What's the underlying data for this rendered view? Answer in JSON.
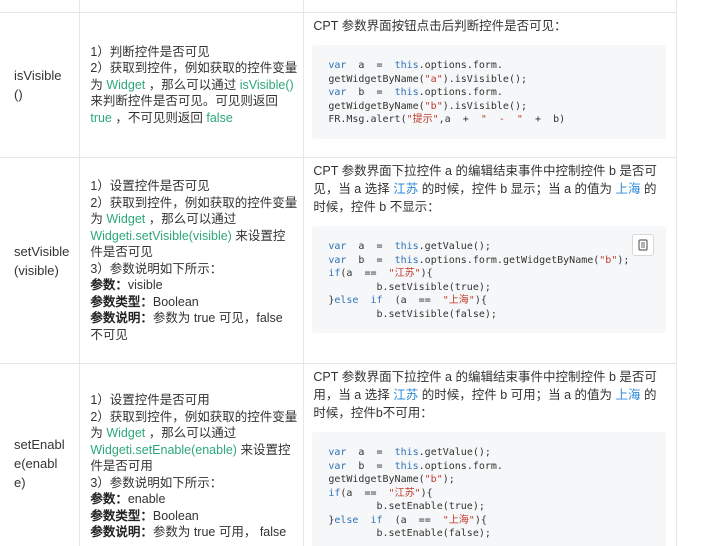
{
  "rows": [
    {
      "name": "isVisible()",
      "desc": {
        "line1": "1）判断控件是否可见",
        "line2a": "2）获取到控件，例如获取的控件变量为",
        "widget": "Widget",
        "line2b": "，那么可以通过",
        "method": "isVisible()",
        "line2c": "来判断控件是否可见。可见则返回",
        "t": "true",
        "line2d": "，不可见则返回",
        "f": "false"
      },
      "intro": "CPT 参数界面按钮点击后判断控件是否可见：",
      "code": {
        "l1a": "var",
        "l1b": "  a  =  ",
        "l1c": "this",
        "l1d": ".options.form.",
        "l2": "getWidgetByName(",
        "l2s": "\"a\"",
        "l2e": ").isVisible();",
        "l3a": "var",
        "l3b": "  b  =  ",
        "l3c": "this",
        "l3d": ".options.form.",
        "l4": "getWidgetByName(",
        "l4s": "\"b\"",
        "l4e": ").isVisible();",
        "l5a": "FR.Msg.alert(",
        "l5s1": "\"提示\"",
        "l5b": ",a  +  ",
        "l5s2": "\"  -  \"",
        "l5c": "  +  b)"
      }
    },
    {
      "name": "setVisible(visible)",
      "desc": {
        "line1": "1）设置控件是否可见",
        "line2a": "2）获取到控件，例如获取的控件变量为",
        "widget": "Widget",
        "line2b": "，那么可以通过",
        "method": "Widgeti.setVisible(visible)",
        "line2c": "来设置控件是否可见",
        "line3": "3）参数说明如下所示：",
        "p1k": "参数：",
        "p1v": "visible",
        "p2k": "参数类型：",
        "p2v": "Boolean",
        "p3k": "参数说明：",
        "p3v": "参数为 true 可见，false 不可见"
      },
      "intro_a": "CPT 参数界面下拉控件 a 的编辑结束事件中控制控件 b 是否可见，当 a 选择",
      "city1": "江苏",
      "intro_b": "的时候，控件 b 显示；当 a 的值为",
      "city2": "上海",
      "intro_c": "的时候，控件 b 不显示：",
      "code": {
        "l1a": "var",
        "l1b": "  a  =  ",
        "l1c": "this",
        "l1d": ".getValue();",
        "l2a": "var",
        "l2b": "  b  =  ",
        "l2c": "this",
        "l2d": ".options.form.getWidgetByName(",
        "l2s": "\"b\"",
        "l2e": ");",
        "l3a": "if",
        "l3b": "(a  ==  ",
        "l3s": "\"江苏\"",
        "l3c": "){",
        "l4": "        b.setVisible(true);",
        "l5a": "}",
        "l5b": "else",
        "l5c": "  ",
        "l5d": "if",
        "l5e": "  (a  ==  ",
        "l5s": "\"上海\"",
        "l5f": "){",
        "l6": "        b.setVisible(false);"
      },
      "copy_icon": "copy-icon"
    },
    {
      "name": "setEnable(enable)",
      "desc": {
        "line1": "1）设置控件是否可用",
        "line2a": "2）获取到控件，例如获取的控件变量为",
        "widget": "Widget",
        "line2b": "，那么可以通过",
        "method": "Widgeti.setEnable(enable)",
        "line2c": "来设置控件是否可用",
        "line3": "3）参数说明如下所示：",
        "p1k": "参数：",
        "p1v": "enable",
        "p2k": "参数类型：",
        "p2v": "Boolean",
        "p3k": "参数说明：",
        "p3v": "参数为 true 可用， false"
      },
      "intro_a": "CPT 参数界面下拉控件 a 的编辑结束事件中控制控件 b 是否可用，当 a 选择",
      "city1": "江苏",
      "intro_b": "的时候，控件 b 可用；当 a 的值为",
      "city2": "上海",
      "intro_c": "的时候，控件b不可用：",
      "code": {
        "l1a": "var",
        "l1b": "  a  =  ",
        "l1c": "this",
        "l1d": ".getValue();",
        "l2a": "var",
        "l2b": "  b  =  ",
        "l2c": "this",
        "l2d": ".options.form.",
        "l3": "getWidgetByName(",
        "l3s": "\"b\"",
        "l3e": ");",
        "l4a": "if",
        "l4b": "(a  ==  ",
        "l4s": "\"江苏\"",
        "l4c": "){",
        "l5": "        b.setEnable(true);",
        "l6a": "}",
        "l6b": "else",
        "l6c": "  ",
        "l6d": "if",
        "l6e": "  (a  ==  ",
        "l6s": "\"上海\"",
        "l6f": "){",
        "l7": "        b.setEnable(false);"
      }
    }
  ]
}
